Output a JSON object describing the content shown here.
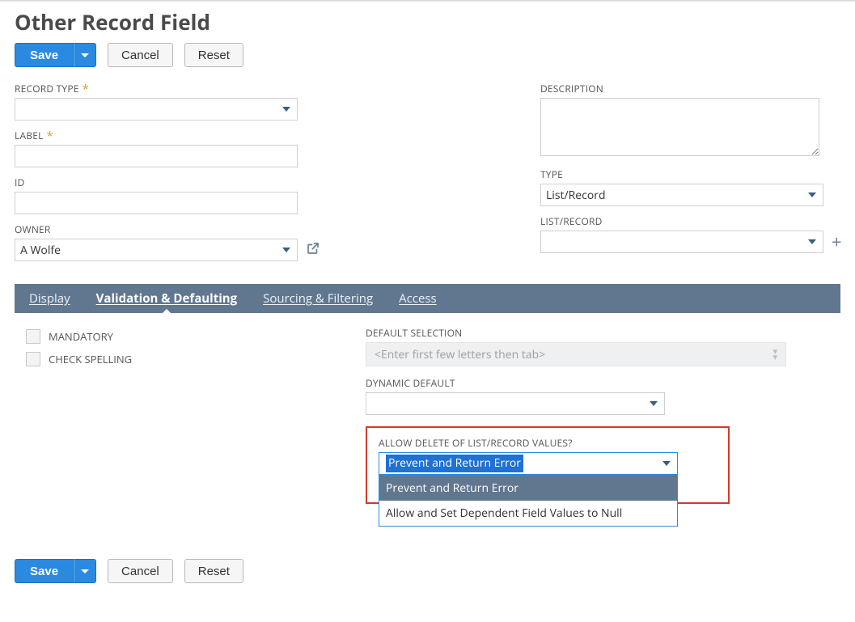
{
  "page_title": "Other Record Field",
  "buttons": {
    "save": "Save",
    "cancel": "Cancel",
    "reset": "Reset"
  },
  "left_fields": {
    "record_type": {
      "label": "RECORD TYPE",
      "required": true,
      "value": ""
    },
    "label": {
      "label": "LABEL",
      "required": true,
      "value": ""
    },
    "id": {
      "label": "ID",
      "required": false,
      "value": ""
    },
    "owner": {
      "label": "OWNER",
      "required": false,
      "value": "A Wolfe"
    }
  },
  "right_fields": {
    "description": {
      "label": "DESCRIPTION",
      "value": ""
    },
    "type": {
      "label": "TYPE",
      "value": "List/Record"
    },
    "list_record": {
      "label": "LIST/RECORD",
      "value": ""
    }
  },
  "tabs": {
    "display": "Display",
    "validation": "Validation & Defaulting",
    "sourcing": "Sourcing & Filtering",
    "access": "Access"
  },
  "validation_tab": {
    "mandatory_label": "MANDATORY",
    "check_spelling_label": "CHECK SPELLING",
    "default_selection": {
      "label": "DEFAULT SELECTION",
      "placeholder": "<Enter first few letters then tab>"
    },
    "dynamic_default": {
      "label": "DYNAMIC DEFAULT",
      "value": ""
    },
    "allow_delete": {
      "label": "ALLOW DELETE OF LIST/RECORD VALUES?",
      "value": "Prevent and Return Error",
      "options": [
        "Prevent and Return Error",
        "Allow and Set Dependent Field Values to Null"
      ]
    }
  }
}
